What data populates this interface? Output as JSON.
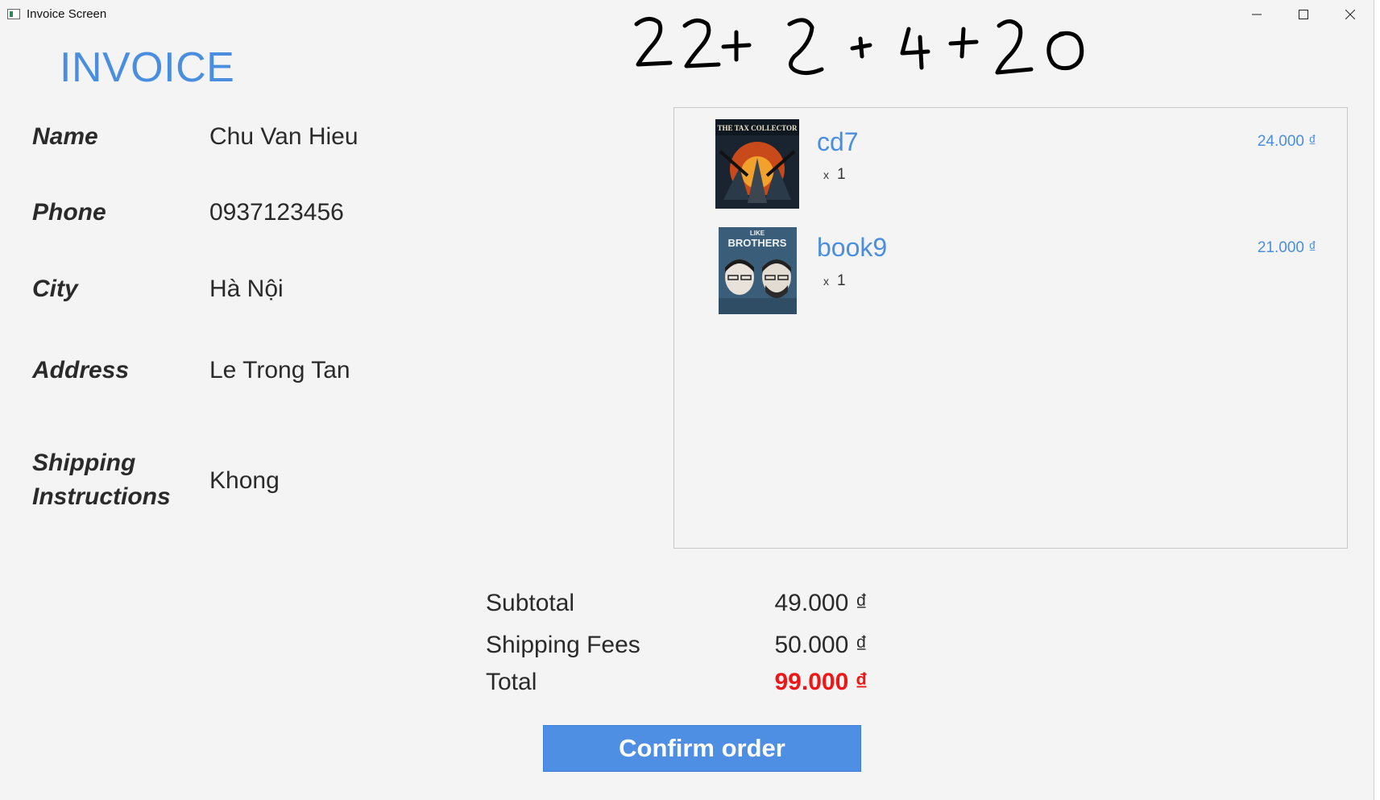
{
  "window": {
    "title": "Invoice Screen"
  },
  "annotation": {
    "handwritten": "22+2+4+20"
  },
  "heading": "INVOICE",
  "fields": [
    {
      "label": "Name",
      "value": "Chu Van Hieu"
    },
    {
      "label": "Phone",
      "value": "0937123456"
    },
    {
      "label": "City",
      "value": "Hà Nội"
    },
    {
      "label": "Address",
      "value": "Le Trong Tan"
    },
    {
      "label_line1": "Shipping",
      "label_line2": "Instructions",
      "value": "Khong"
    }
  ],
  "cart": {
    "items": [
      {
        "name": "cd7",
        "qty_prefix": "x",
        "qty": "1",
        "price": "24.000 ₫",
        "cover_text": "THE TAX COLLECTOR"
      },
      {
        "name": "book9",
        "qty_prefix": "x",
        "qty": "1",
        "price": "21.000 ₫",
        "cover_text_top": "LIKE",
        "cover_text_main": "BROTHERS"
      }
    ]
  },
  "summary": {
    "subtotal_label": "Subtotal",
    "subtotal_value": "49.000 ₫",
    "shipping_label": "Shipping Fees",
    "shipping_value": "50.000 ₫",
    "total_label": "Total",
    "total_value": "99.000 ₫"
  },
  "actions": {
    "confirm_label": "Confirm order"
  },
  "colors": {
    "accent": "#4a8ee0",
    "button": "#4f8fe3",
    "total": "#f01616",
    "background": "#f4f4f4"
  }
}
